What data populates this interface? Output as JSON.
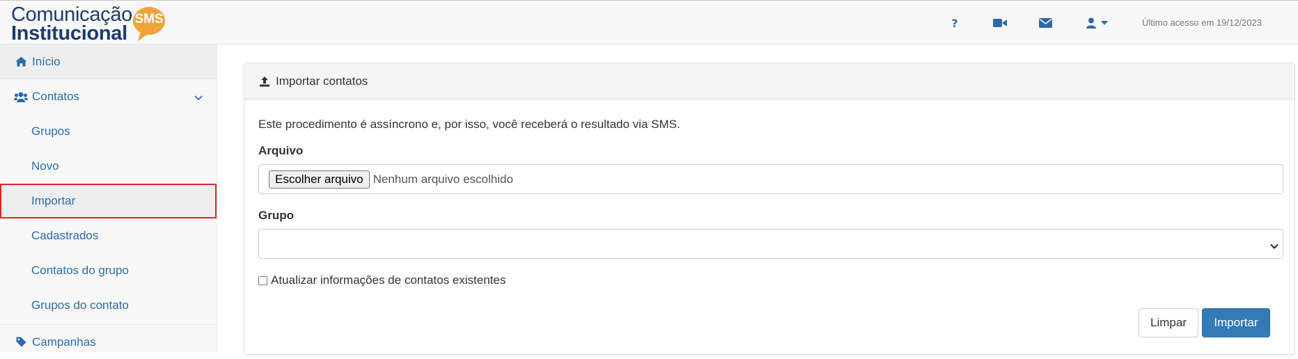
{
  "header": {
    "logo": {
      "line1": "Comunicação",
      "line2": "Institucional",
      "badge": "SMS"
    },
    "icons": [
      "help-icon",
      "video-icon",
      "envelope-icon",
      "user-icon",
      "caret-down-icon"
    ],
    "last_access": "Último acesso em 19/12/2023"
  },
  "sidebar": {
    "inicio": "Início",
    "contatos": "Contatos",
    "contatos_items": [
      "Grupos",
      "Novo",
      "Importar",
      "Cadastrados",
      "Contatos do grupo",
      "Grupos do contato"
    ],
    "selected": "Importar",
    "campanhas": "Campanhas"
  },
  "main": {
    "panel_title": "Importar contatos",
    "info": "Este procedimento é assíncrono e, por isso, você receberá o resultado via SMS.",
    "file_label": "Arquivo",
    "file_button": "Escolher arquivo",
    "file_status": "Nenhum arquivo escolhido",
    "group_label": "Grupo",
    "group_value": "",
    "checkbox_label": "Atualizar informações de contatos existentes",
    "checkbox_checked": false,
    "btn_clear": "Limpar",
    "btn_import": "Importar"
  },
  "colors": {
    "link": "#2c6aa8",
    "primary_button": "#337ab7",
    "logo_text": "#1e3a6e",
    "logo_badge": "#f0a33a",
    "selection_outline": "#e02424"
  }
}
